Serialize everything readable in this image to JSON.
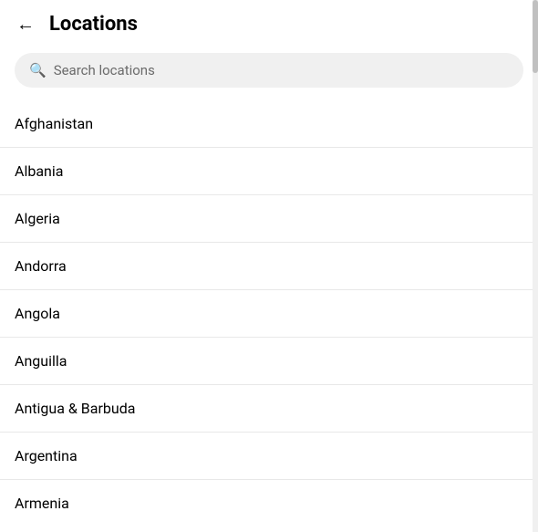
{
  "header": {
    "title": "Locations",
    "back_label": "←"
  },
  "search": {
    "placeholder": "Search locations"
  },
  "locations": [
    "Afghanistan",
    "Albania",
    "Algeria",
    "Andorra",
    "Angola",
    "Anguilla",
    "Antigua & Barbuda",
    "Argentina",
    "Armenia"
  ]
}
